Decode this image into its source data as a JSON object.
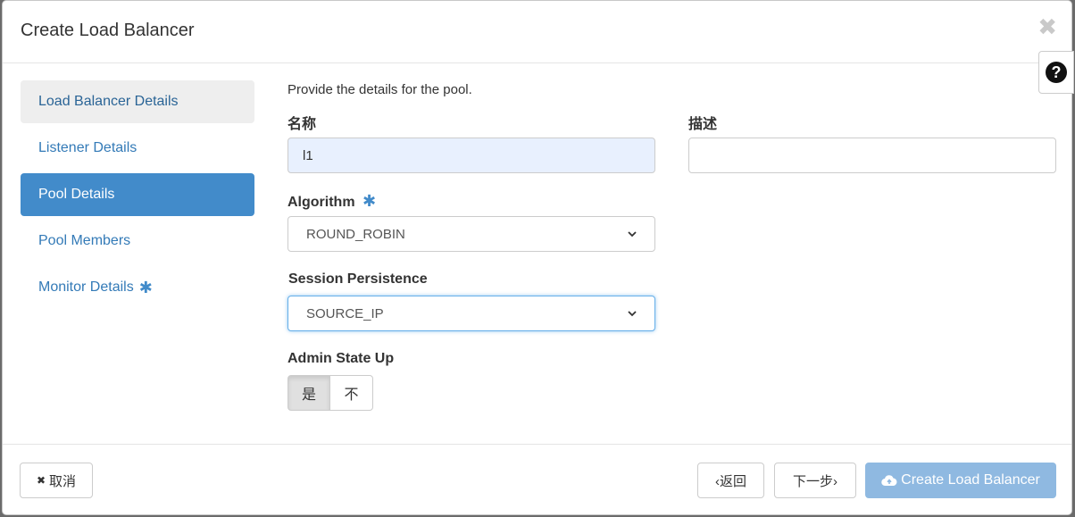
{
  "dialog": {
    "title": "Create Load Balancer",
    "close_glyph": "✖",
    "help_glyph": "?"
  },
  "nav": {
    "items": [
      {
        "label": "Load Balancer Details",
        "state": "visited"
      },
      {
        "label": "Listener Details",
        "state": "normal"
      },
      {
        "label": "Pool Details",
        "state": "active"
      },
      {
        "label": "Pool Members",
        "state": "normal"
      },
      {
        "label": "Monitor Details",
        "state": "required"
      }
    ],
    "required_marker": "✱"
  },
  "form": {
    "intro": "Provide the details for the pool.",
    "name_label": "名称",
    "name_value": "l1",
    "description_label": "描述",
    "description_value": "",
    "algorithm_label": "Algorithm",
    "algorithm_required": "✱",
    "algorithm_value": "ROUND_ROBIN",
    "session_label": "Session Persistence",
    "session_value": "SOURCE_IP",
    "admin_label": "Admin State Up",
    "admin_yes": "是",
    "admin_no": "不"
  },
  "footer": {
    "cancel_icon": "✖",
    "cancel_label": "取消",
    "back_label": "‹返回",
    "next_label": "下一步›",
    "create_label": "Create Load Balancer"
  },
  "colors": {
    "accent": "#428bca",
    "link": "#337ab7",
    "primary_disabled": "#8fb9e1"
  }
}
